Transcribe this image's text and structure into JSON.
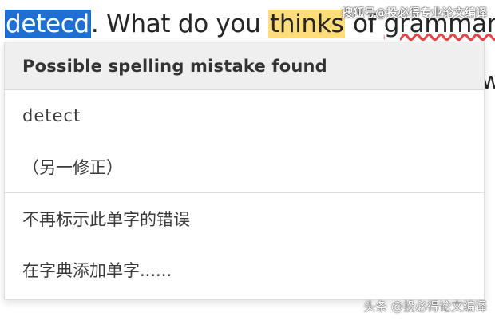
{
  "document": {
    "selected_word": "detecd",
    "text_after_selected": ". What do you ",
    "highlighted_word": "thinks",
    "text_after_highlight": " of ",
    "underlined_word": "grammar",
    "text_tail": " c",
    "right_fragment": "w"
  },
  "popup": {
    "title": "Possible spelling mistake found",
    "suggestions": [
      "detect",
      "（另一修正）"
    ],
    "actions": [
      "不再标示此单字的错误",
      "在字典添加单字......"
    ]
  },
  "watermarks": {
    "top": "搜狐号@投必得专业论文编译",
    "bottom": "头条 @投必得论文编译"
  },
  "colors": {
    "selection": "#1e6fd1",
    "highlight": "#ffdd7a",
    "popup_header_bg": "#efefef"
  }
}
